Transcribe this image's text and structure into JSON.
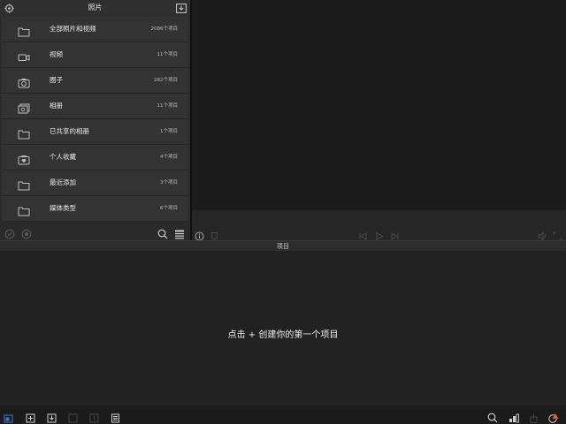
{
  "browser": {
    "title": "照片",
    "settings_icon": "gear-icon",
    "import_icon": "import-icon",
    "albums": [
      {
        "label": "全部照片和视频",
        "count": "2086个项目",
        "icon": "folder-icon"
      },
      {
        "label": "视频",
        "count": "11个项目",
        "icon": "video-camera-icon"
      },
      {
        "label": "圈子",
        "count": "282个项目",
        "icon": "camera-icon"
      },
      {
        "label": "相册",
        "count": "11个项目",
        "icon": "photo-stack-icon"
      },
      {
        "label": "已共享的相册",
        "count": "1个项目",
        "icon": "folder-icon"
      },
      {
        "label": "个人收藏",
        "count": "4个项目",
        "icon": "camera-heart-icon"
      },
      {
        "label": "最近添加",
        "count": "3个项目",
        "icon": "folder-icon"
      },
      {
        "label": "媒体类型",
        "count": "6个项目",
        "icon": "folder-icon"
      }
    ]
  },
  "projects": {
    "title": "项目",
    "empty_message": "点击 + 创建你的第一个项目"
  },
  "colors": {
    "accent": "#3b7bd6",
    "warning": "#e25a2b"
  }
}
